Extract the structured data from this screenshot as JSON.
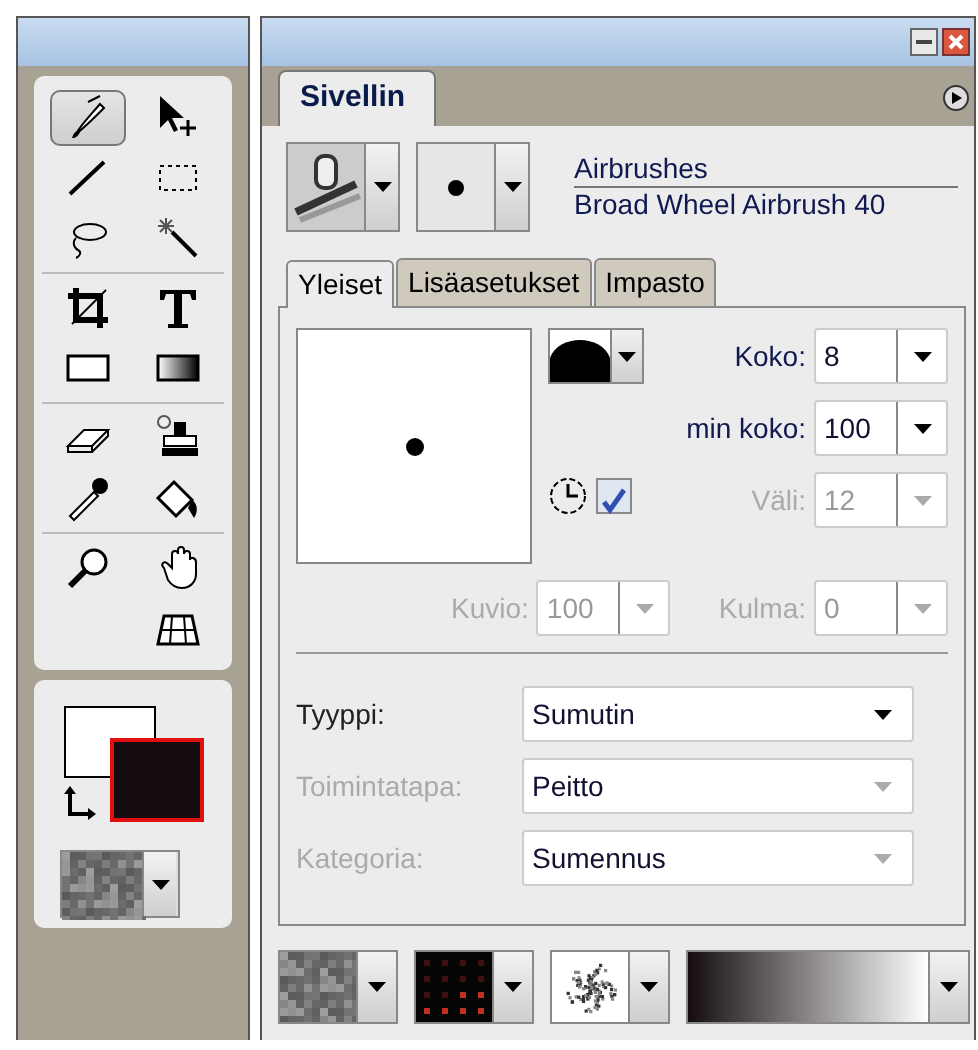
{
  "toolbox": {
    "groups": [
      {
        "tools": [
          {
            "kind": "brush",
            "selected": true
          },
          {
            "kind": "move",
            "selected": false
          },
          {
            "kind": "line",
            "selected": false
          },
          {
            "kind": "marquee",
            "selected": false
          },
          {
            "kind": "lasso",
            "selected": false
          },
          {
            "kind": "wand",
            "selected": false
          }
        ]
      },
      {
        "tools": [
          {
            "kind": "crop",
            "selected": false
          },
          {
            "kind": "text",
            "selected": false
          },
          {
            "kind": "rect",
            "selected": false
          },
          {
            "kind": "gradient",
            "selected": false
          }
        ]
      },
      {
        "tools": [
          {
            "kind": "eraser",
            "selected": false
          },
          {
            "kind": "stamp",
            "selected": false
          },
          {
            "kind": "dropper",
            "selected": false
          },
          {
            "kind": "bucket",
            "selected": false
          }
        ]
      },
      {
        "tools": [
          {
            "kind": "zoom",
            "selected": false
          },
          {
            "kind": "hand",
            "selected": false
          },
          {
            "kind": "grid",
            "selected": false
          }
        ]
      }
    ]
  },
  "panel": {
    "tab": {
      "label": "Sivellin",
      "selected": true
    },
    "brush": {
      "category": "Airbrushes",
      "variant": "Broad Wheel Airbrush 40"
    },
    "subtabs": [
      {
        "label": "Yleiset",
        "selected": true
      },
      {
        "label": "Lisäasetukset",
        "selected": false
      },
      {
        "label": "Impasto",
        "selected": false
      }
    ],
    "size_fields": [
      {
        "label": "Koko:",
        "value": "8",
        "disabled": false
      },
      {
        "label": "min koko:",
        "value": "100",
        "disabled": false
      },
      {
        "label": "Väli:",
        "value": "12",
        "disabled": true
      }
    ],
    "timer_checked": true,
    "row_fields": [
      {
        "label": "Kuvio:",
        "value": "100",
        "disabled": true
      },
      {
        "label": "Kulma:",
        "value": "0",
        "disabled": true
      }
    ],
    "dropdowns": [
      {
        "label": "Tyyppi:",
        "value": "Sumutin",
        "disabled": false
      },
      {
        "label": "Toimintatapa:",
        "value": "Peitto",
        "disabled": true
      },
      {
        "label": "Kategoria:",
        "value": "Sumennus",
        "disabled": true
      }
    ],
    "swatches": [
      {
        "kind": "paper"
      },
      {
        "kind": "pattern"
      },
      {
        "kind": "texture"
      },
      {
        "kind": "gradient"
      }
    ]
  }
}
